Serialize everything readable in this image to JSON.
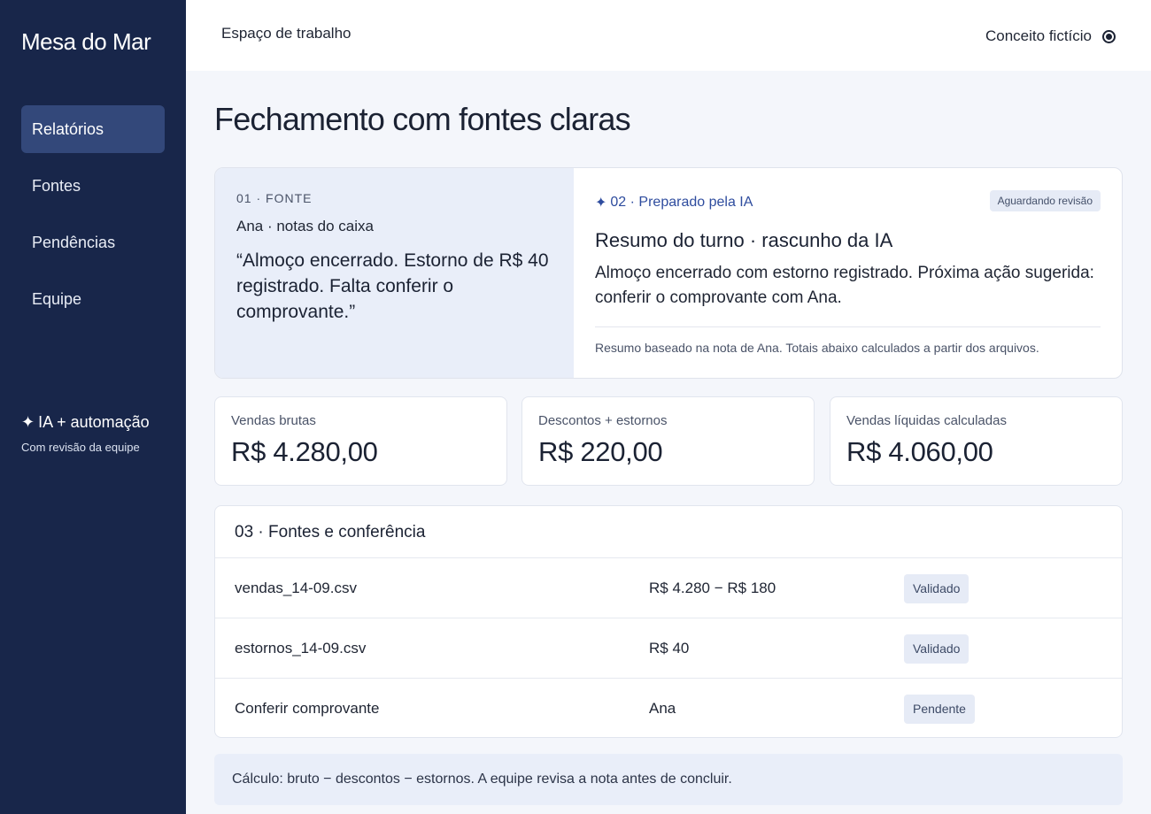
{
  "sidebar": {
    "brand": "Mesa do Mar",
    "items": [
      {
        "label": "Relatórios"
      },
      {
        "label": "Fontes"
      },
      {
        "label": "Pendências"
      },
      {
        "label": "Equipe"
      }
    ],
    "ai_title": "IA + automação",
    "ai_subtitle": "Com revisão da equipe"
  },
  "topbar": {
    "workspace": "Espaço de trabalho",
    "concept": "Conceito fictício"
  },
  "page": {
    "title": "Fechamento com fontes claras"
  },
  "source": {
    "kicker": "01 · FONTE",
    "author": "Ana · notas do caixa",
    "quote": "“Almoço encerrado. Estorno de R$ 40 registrado. Falta conferir o comprovante.”"
  },
  "ai_draft": {
    "kicker": "02 · Preparado pela IA",
    "badge": "Aguardando revisão",
    "heading": "Resumo do turno · rascunho da IA",
    "body": "Almoço encerrado com estorno registrado. Próxima ação sugerida: conferir o comprovante com Ana.",
    "footnote": "Resumo baseado na nota de Ana. Totais abaixo calculados a partir dos arquivos."
  },
  "metrics": [
    {
      "label": "Vendas brutas",
      "value": "R$ 4.280,00"
    },
    {
      "label": "Descontos + estornos",
      "value": "R$ 220,00"
    },
    {
      "label": "Vendas líquidas calculadas",
      "value": "R$ 4.060,00"
    }
  ],
  "table": {
    "title": "03 · Fontes e conferência",
    "rows": [
      {
        "name": "vendas_14-09.csv",
        "value": "R$ 4.280 − R$ 180",
        "status": "Validado"
      },
      {
        "name": "estornos_14-09.csv",
        "value": "R$ 40",
        "status": "Validado"
      },
      {
        "name": "Conferir comprovante",
        "value": "Ana",
        "status": "Pendente"
      }
    ]
  },
  "calc_note": "Cálculo: bruto − descontos − estornos. A equipe revisa a nota antes de concluir.",
  "icons": {
    "sparkle": "sparkle-icon",
    "radio": "radio-icon"
  },
  "colors": {
    "sidebar_bg": "#18264a",
    "nav_active_bg": "#33487a",
    "accent": "#2e4c9e",
    "source_bg": "#e9eef9",
    "badge_bg": "#e6ebf6"
  }
}
